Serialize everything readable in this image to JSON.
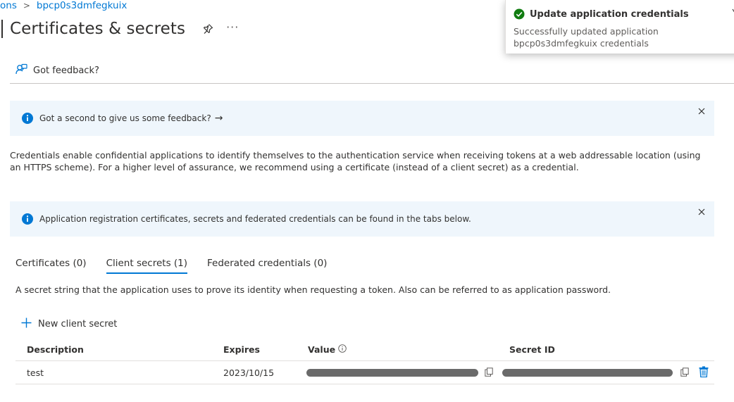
{
  "breadcrumb": {
    "items": [
      "ons",
      "bpcp0s3dmfegkuix"
    ],
    "separator": ">"
  },
  "page": {
    "title": "Certificates & secrets",
    "more": "···"
  },
  "toolbar": {
    "feedback_label": "Got feedback?"
  },
  "banners": {
    "feedback": {
      "text": "Got a second to give us some feedback?",
      "arrow": "→"
    },
    "tabs_info": {
      "text": "Application registration certificates, secrets and federated credentials can be found in the tabs below."
    }
  },
  "description": "Credentials enable confidential applications to identify themselves to the authentication service when receiving tokens at a web addressable location (using an HTTPS scheme). For a higher level of assurance, we recommend using a certificate (instead of a client secret) as a credential.",
  "tabs": [
    {
      "label": "Certificates (0)",
      "active": false
    },
    {
      "label": "Client secrets (1)",
      "active": true
    },
    {
      "label": "Federated credentials (0)",
      "active": false
    }
  ],
  "tab_description": "A secret string that the application uses to prove its identity when requesting a token. Also can be referred to as application password.",
  "actions": {
    "new_client_secret": "New client secret"
  },
  "table": {
    "columns": [
      "Description",
      "Expires",
      "Value",
      "Secret ID"
    ],
    "rows": [
      {
        "description": "test",
        "expires": "2023/10/15"
      }
    ]
  },
  "toast": {
    "title": "Update application credentials",
    "message": "Successfully updated application bpcp0s3dmfegkuix credentials"
  },
  "colors": {
    "accent": "#0078d4",
    "success": "#107c10",
    "banner_bg": "#eff6fc"
  },
  "icons": {
    "breadcrumb_sep": "chevron-right-icon",
    "pin": "pin-icon",
    "feedback": "feedback-person-icon",
    "info": "info-icon",
    "close": "close-icon",
    "add": "plus-icon",
    "copy": "copy-icon",
    "delete": "trash-icon",
    "success": "checkmark-circle-icon"
  }
}
